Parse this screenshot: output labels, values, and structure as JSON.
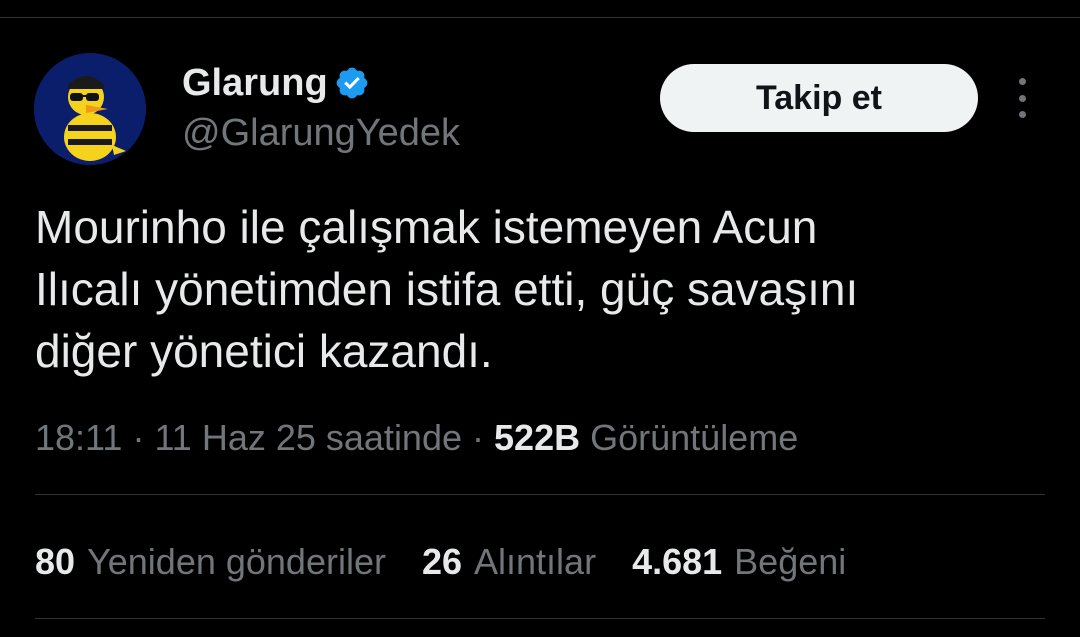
{
  "author": {
    "display_name": "Glarung",
    "handle": "@GlarungYedek",
    "verified": true,
    "avatar_icon": "yellow-duck-with-sunglasses-avatar"
  },
  "follow_label": "Takip et",
  "more_icon": "more-vertical-icon",
  "tweet": {
    "text": "Mourinho ile çalışmak istemeyen Acun\nIlıcalı yönetimden istifa etti, güç savaşını\ndiğer yönetici kazandı."
  },
  "meta": {
    "time": "18:11",
    "separator": "·",
    "date": "11 Haz 25 saatinde",
    "views_count": "522B",
    "views_label": "Görüntüleme"
  },
  "stats": [
    {
      "count": "80",
      "label": "Yeniden gönderiler"
    },
    {
      "count": "26",
      "label": "Alıntılar"
    },
    {
      "count": "4.681",
      "label": "Beğeni"
    }
  ],
  "colors": {
    "background": "#000000",
    "text_primary": "#e7e9ea",
    "text_secondary": "#71767b",
    "divider": "#2f3336",
    "verified_blue": "#1d9bf0",
    "follow_bg": "#eff3f4"
  }
}
